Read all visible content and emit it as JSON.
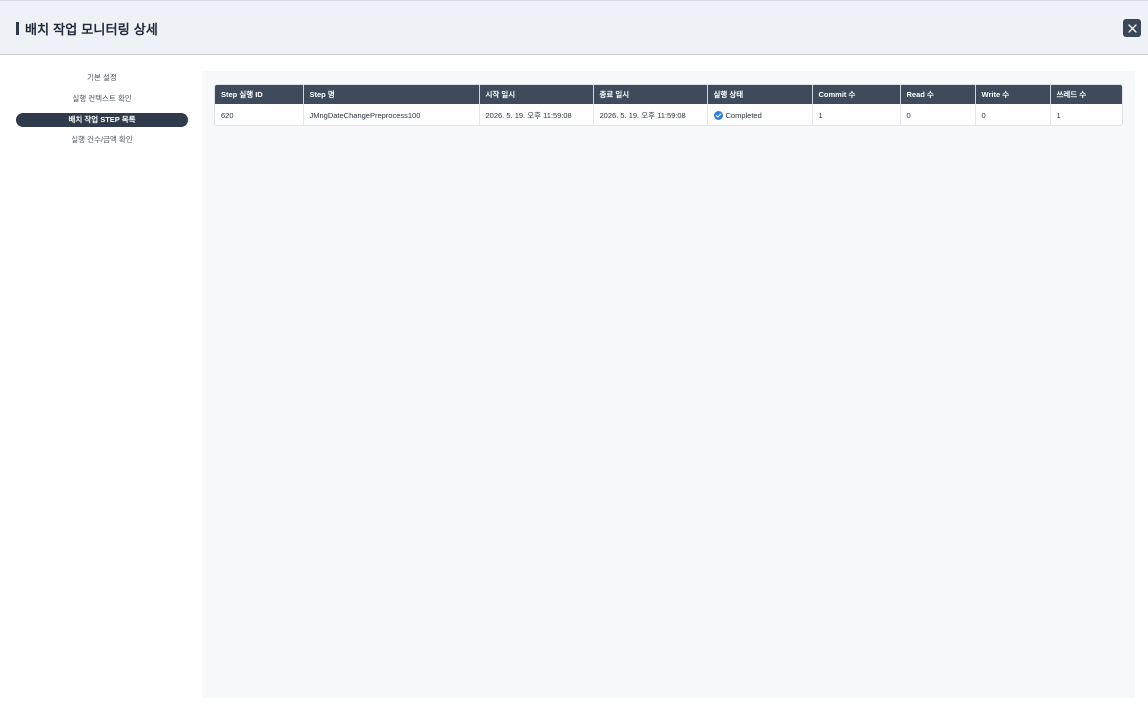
{
  "header": {
    "title": "배치 작업 모니터링 상세",
    "close_icon": "close-icon"
  },
  "sidebar": {
    "items": [
      {
        "label": "기본 설정",
        "active": false
      },
      {
        "label": "실행 컨텍스트 확인",
        "active": false
      },
      {
        "label": "배치 작업 STEP 목록",
        "active": true
      },
      {
        "label": "실행 건수/금액 확인",
        "active": false
      }
    ]
  },
  "table": {
    "columns": [
      "Step 실행 ID",
      "Step 명",
      "시작 일시",
      "종료 일시",
      "실행 상태",
      "Commit 수",
      "Read 수",
      "Write 수",
      "쓰레드 수"
    ],
    "rows": [
      {
        "step_exec_id": "620",
        "step_name": "JMngDateChangePreprocess100",
        "start_time": "2026. 5. 19. 오후 11:59:08",
        "end_time": "2026. 5. 19. 오후 11:59:08",
        "status": "Completed",
        "status_icon": "check-circle-icon",
        "commit_count": "1",
        "read_count": "0",
        "write_count": "0",
        "thread_count": "1"
      }
    ]
  },
  "colors": {
    "header_bg": "#eef1f5",
    "accent_dark": "#2f3b4b",
    "table_header_bg": "#3f4b5c",
    "status_completed": "#2f80d6"
  }
}
